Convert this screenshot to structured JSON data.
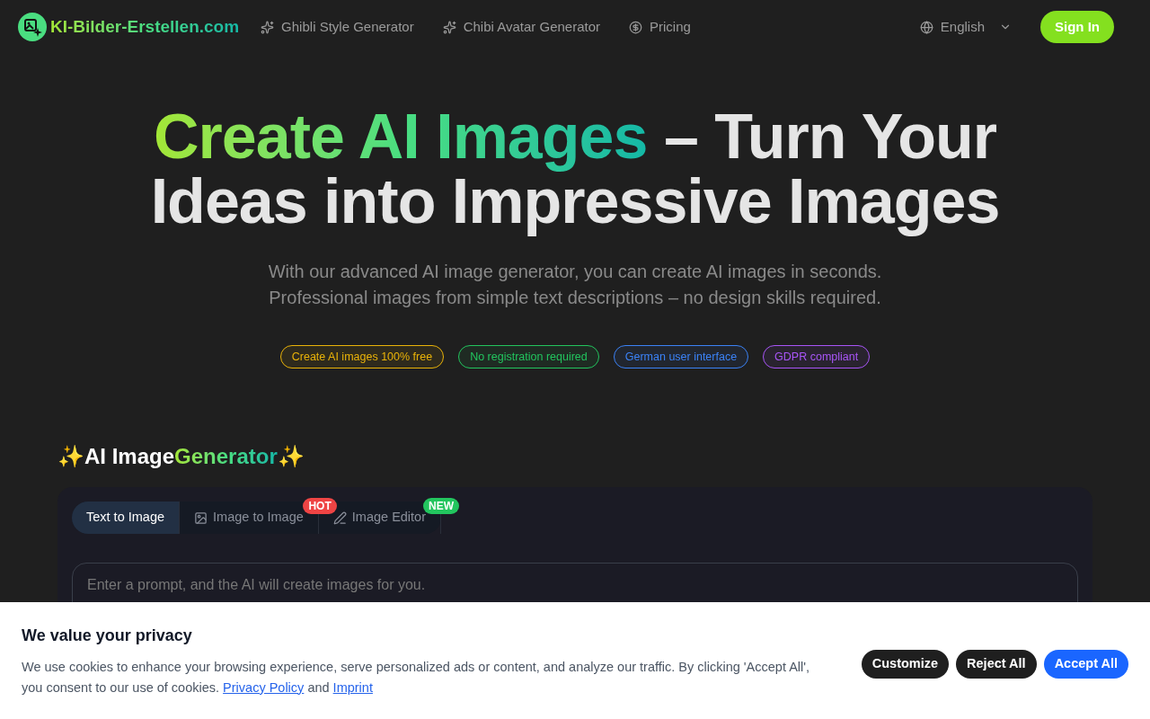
{
  "header": {
    "logo": "KI-Bilder-Erstellen.com",
    "nav": [
      {
        "label": "Ghibli Style Generator",
        "kind": "sparkle"
      },
      {
        "label": "Chibi Avatar Generator",
        "kind": "sparkle"
      },
      {
        "label": "Pricing",
        "kind": "coin"
      }
    ],
    "language": "English",
    "sign_in": "Sign In"
  },
  "hero": {
    "title_highlight": "Create AI Images",
    "title_line1": "– Turn Your",
    "title_line2": "Ideas into Impressive Images",
    "subtitle": [
      "With our advanced AI image generator, you can create AI images in seconds.",
      "Professional images from simple text descriptions – no design skills required."
    ],
    "tags": [
      {
        "label": "Create AI images 100% free",
        "color": "#eab308"
      },
      {
        "label": "No registration required",
        "color": "#22c55e"
      },
      {
        "label": "German user interface",
        "color": "#3b82f6"
      },
      {
        "label": "GDPR compliant",
        "color": "#a855f7"
      }
    ]
  },
  "generator": {
    "heading_lead": "✨",
    "heading_plain": "AI Image",
    "heading_highlight": "Generator",
    "heading_trail": "✨",
    "tabs": [
      {
        "label": "Text to Image",
        "selected": true,
        "kind": "text"
      },
      {
        "label": "Image to Image",
        "selected": false,
        "kind": "image",
        "badge": "HOT"
      },
      {
        "label": "Image Editor",
        "selected": false,
        "kind": "editor",
        "badge": "NEW"
      }
    ],
    "prompt": {
      "placeholder": "Enter a prompt, and the AI will create images for you."
    }
  },
  "cookie": {
    "title": "We value your privacy",
    "text": "We use cookies to enhance your browsing experience, serve personalized ads or content, and analyze our traffic. By clicking 'Accept All', you consent to our use of cookies.",
    "privacy_link": "Privacy Policy",
    "and": "and",
    "imprint_link": "Imprint",
    "buttons": [
      {
        "label": "Customize",
        "kind": "dark"
      },
      {
        "label": "Reject All",
        "kind": "dark"
      },
      {
        "label": "Accept All",
        "kind": "primary"
      }
    ]
  }
}
